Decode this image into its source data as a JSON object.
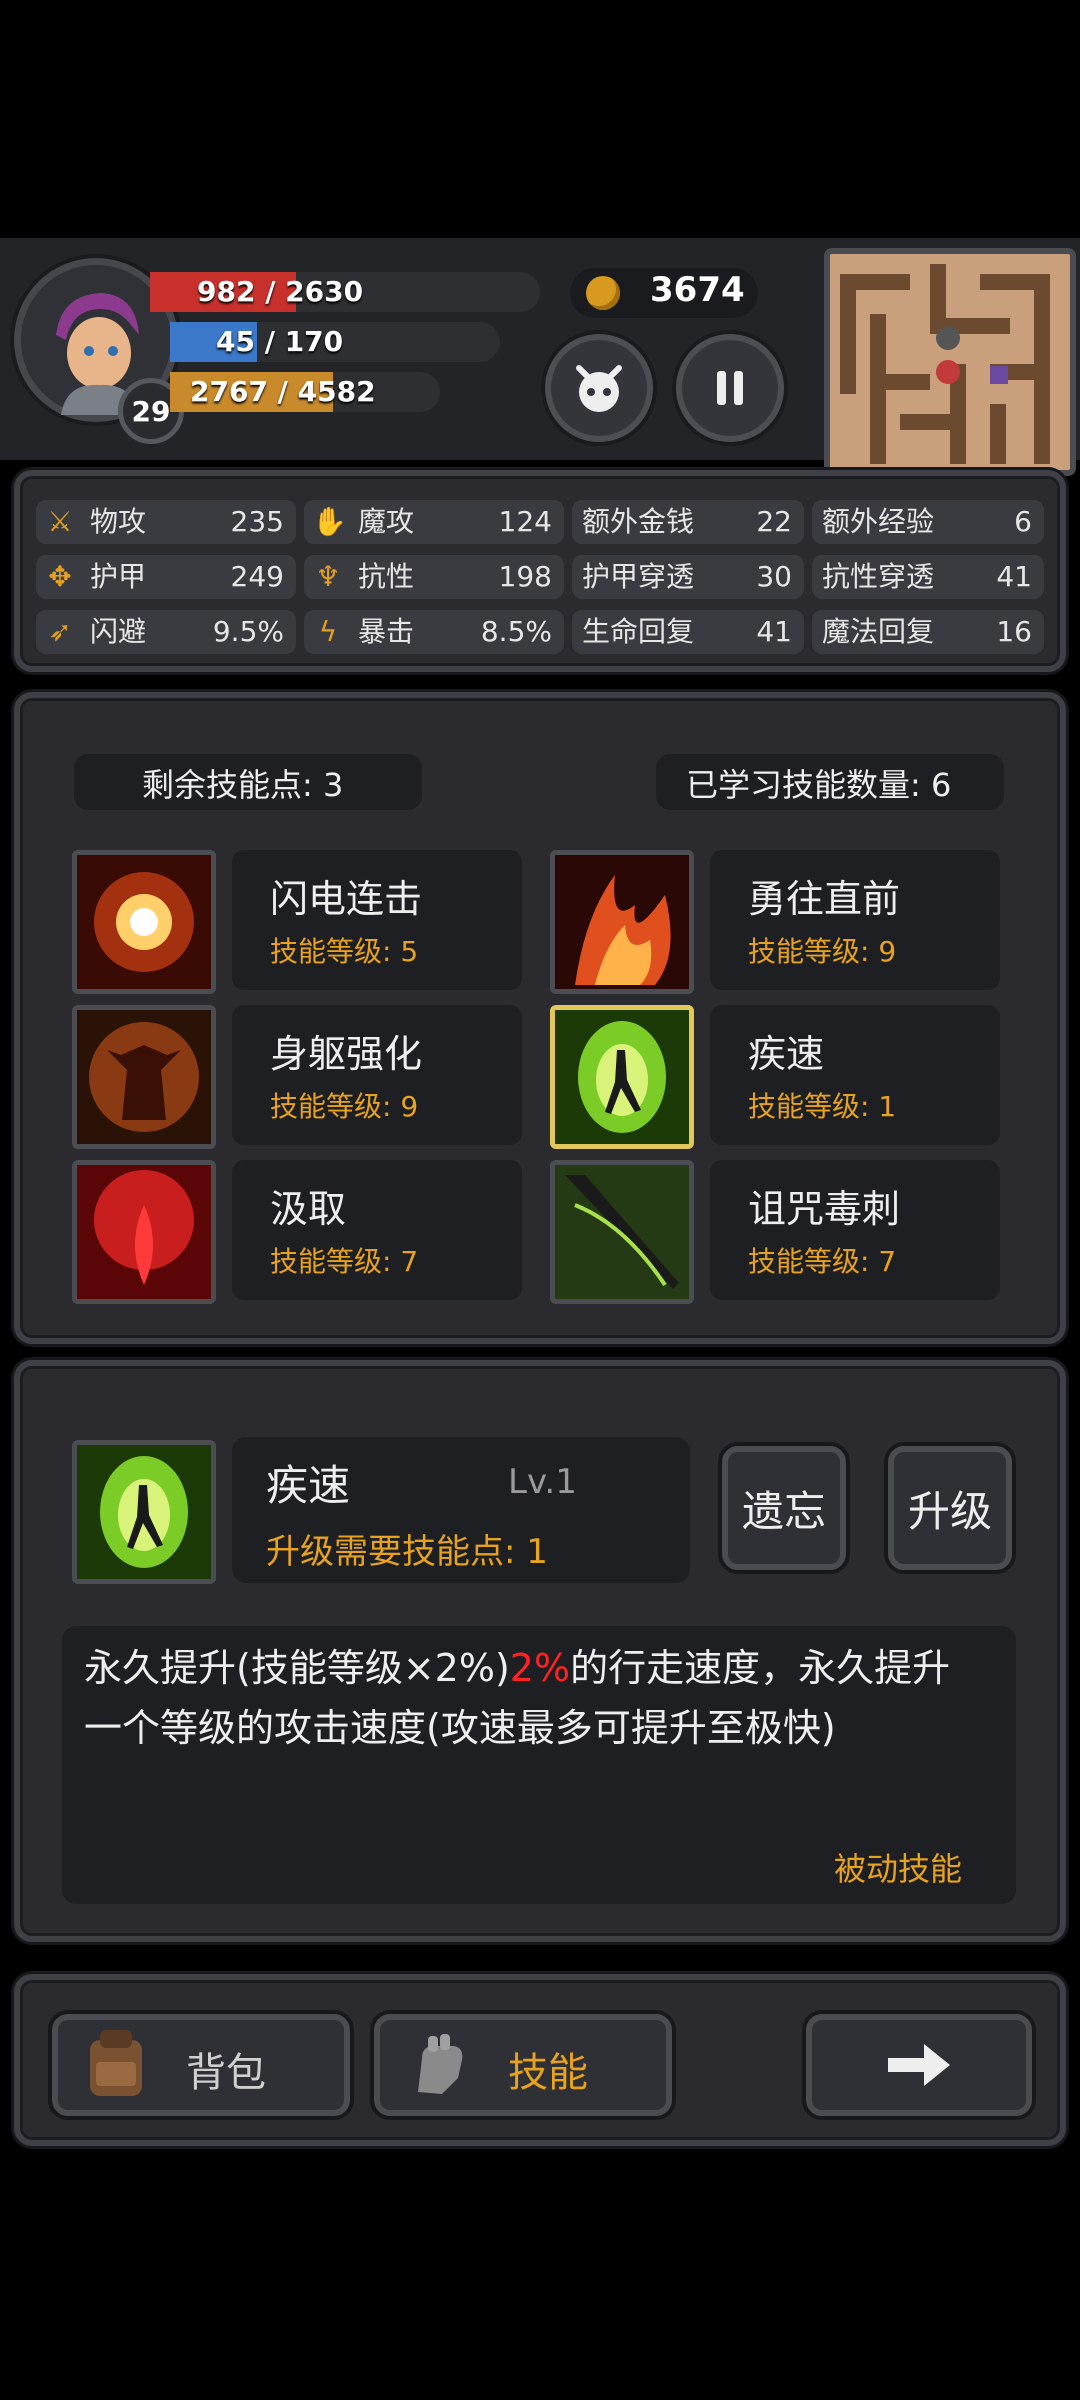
{
  "hud": {
    "hp": {
      "current": 982,
      "max": 2630,
      "text": "982 / 2630",
      "color": "#c8302c"
    },
    "mp": {
      "current": 45,
      "max": 170,
      "text": "45 / 170",
      "color": "#3b78c9"
    },
    "xp": {
      "current": 2767,
      "max": 4582,
      "text": "2767 / 4582",
      "color": "#c98a2c"
    },
    "level": "29",
    "gold": "3674"
  },
  "stats": [
    {
      "icon": "sword-icon",
      "name": "物攻",
      "value": "235"
    },
    {
      "icon": "magic-hand-icon",
      "name": "魔攻",
      "value": "124"
    },
    {
      "icon": "",
      "name": "额外金钱",
      "value": "22"
    },
    {
      "icon": "",
      "name": "额外经验",
      "value": "6"
    },
    {
      "icon": "paw-armor-icon",
      "name": "护甲",
      "value": "249"
    },
    {
      "icon": "resist-icon",
      "name": "抗性",
      "value": "198"
    },
    {
      "icon": "",
      "name": "护甲穿透",
      "value": "30"
    },
    {
      "icon": "",
      "name": "抗性穿透",
      "value": "41"
    },
    {
      "icon": "dodge-runner-icon",
      "name": "闪避",
      "value": "9.5%"
    },
    {
      "icon": "lightning-icon",
      "name": "暴击",
      "value": "8.5%"
    },
    {
      "icon": "",
      "name": "生命回复",
      "value": "41"
    },
    {
      "icon": "",
      "name": "魔法回复",
      "value": "16"
    }
  ],
  "skills_header": {
    "remaining": "剩余技能点: 3",
    "learned": "已学习技能数量: 6"
  },
  "skills": [
    {
      "name": "闪电连击",
      "level": "技能等级: 5",
      "icon": "lightning-burst-icon",
      "color": "#e06a1e"
    },
    {
      "name": "勇往直前",
      "level": "技能等级: 9",
      "icon": "flame-icon",
      "color": "#e0501e"
    },
    {
      "name": "身躯强化",
      "level": "技能等级: 9",
      "icon": "demon-body-icon",
      "color": "#b5541a"
    },
    {
      "name": "疾速",
      "level": "技能等级: 1",
      "icon": "haste-runner-icon",
      "color": "#7ccc28",
      "selected": true
    },
    {
      "name": "汲取",
      "level": "技能等级: 7",
      "icon": "blood-drop-icon",
      "color": "#c81e1e"
    },
    {
      "name": "诅咒毒刺",
      "level": "技能等级: 7",
      "icon": "poison-blade-icon",
      "color": "#7ab53a"
    }
  ],
  "detail": {
    "name": "疾速",
    "lv": "Lv.1",
    "cost": "升级需要技能点: 1",
    "forget": "遗忘",
    "upgrade": "升级",
    "desc_before": "永久提升(技能等级×2%)",
    "desc_highlight": "2%",
    "desc_after": "的行走速度，永久提升一个等级的攻击速度(攻速最多可提升至极快)",
    "type": "被动技能"
  },
  "bottom_nav": {
    "bag": "背包",
    "skills": "技能"
  },
  "colors": {
    "accent": "#e7a21f",
    "highlight": "#ff2222",
    "panel": "#2b2b2f"
  }
}
